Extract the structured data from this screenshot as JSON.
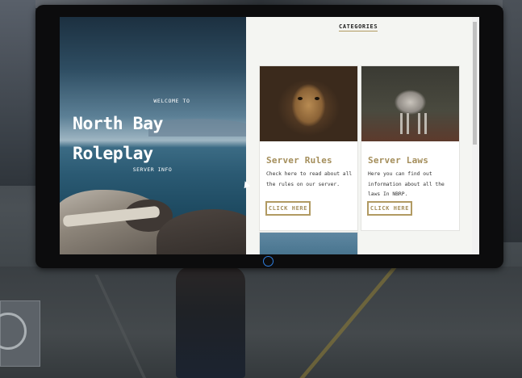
{
  "hero": {
    "welcome": "WELCOME TO",
    "title_line1": "North Bay",
    "title_line2": "Roleplay",
    "server_info": "SERVER INFO"
  },
  "content": {
    "heading": "CATEGORIES",
    "cards": [
      {
        "title": "Server Rules",
        "text": "Check here to read about all the rules on our server.",
        "button": "CLICK HERE",
        "image": "lioness-photo"
      },
      {
        "title": "Server Laws",
        "text": "Here you can find out information about all the laws In NBRP.",
        "button": "CLICK HERE",
        "image": "wolf-photo"
      }
    ]
  },
  "colors": {
    "accent": "#a48e5b",
    "home_button": "#2f7fe0"
  }
}
